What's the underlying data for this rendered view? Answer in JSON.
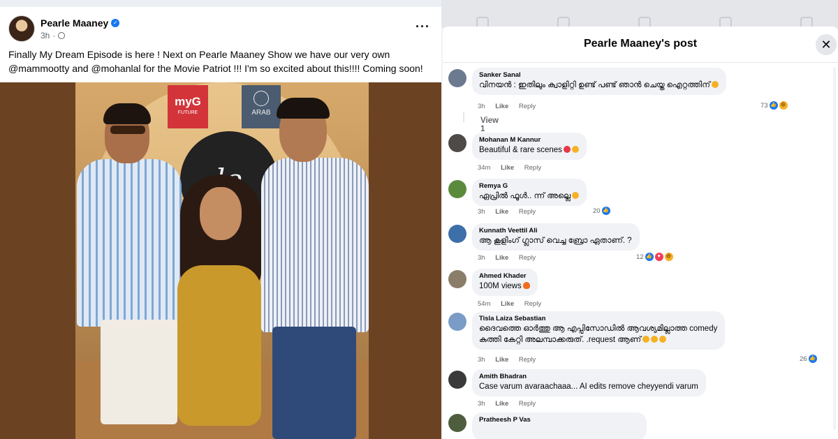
{
  "post": {
    "author": "Pearle Maaney",
    "time": "3h",
    "text": "Finally My Dream Episode is here ! Next on Pearle Maaney Show we have our very own @mammootty and @mohanlal for the Movie Patriot !!! I'm so excited about this!!!! Coming soon!",
    "photo": {
      "logo_myg": "myG",
      "logo_myg_sub": "FUTURE",
      "logo_arab": "ARAB",
      "ring_text": "le"
    }
  },
  "dialog": {
    "title": "Pearle Maaney's post",
    "close_icon": "close-icon"
  },
  "comments": [
    {
      "name": "Sanker Sanal",
      "text": "വിനയൻ : ഇതിലും ക്വാളിറ്റി ഉണ്ട് പണ്ട് ഞാൻ ചെയ്ത ഐറ്റത്തിന്",
      "time": "3h",
      "like": "Like",
      "reply": "Reply",
      "reactions": "73",
      "view_replies": "View 1 reply",
      "avatar_color": "#6b7a8f"
    },
    {
      "name": "Mohanan M Kannur",
      "text": "Beautiful & rare scenes",
      "time": "34m",
      "like": "Like",
      "reply": "Reply",
      "avatar_color": "#4e4a48"
    },
    {
      "name": "Remya G",
      "text": "ഏപ്രിൽ ഫൂൾ.. ന്ന് അല്ലെ",
      "time": "3h",
      "like": "Like",
      "reply": "Reply",
      "reactions": "20",
      "avatar_color": "#5b8a3c"
    },
    {
      "name": "Kunnath Veettil Ali",
      "text": "ആ കൂളിംഗ് ഗ്ലാസ്‌ വെച്ച ബ്രോ ഏതാണ്. ?",
      "time": "3h",
      "like": "Like",
      "reply": "Reply",
      "reactions": "12",
      "avatar_color": "#3d6fa8"
    },
    {
      "name": "Ahmed Khader",
      "text": "100M views",
      "time": "54m",
      "like": "Like",
      "reply": "Reply",
      "avatar_color": "#8a7d6a"
    },
    {
      "name": "Tisla Laiza Sebastian",
      "text_line1": "ദൈവത്തെ ഓർത്തു ആ എപ്പിസോഡിൽ ആവശ്യമില്ലാത്ത comedy",
      "text_line2": "കുത്തി കേറ്റി അലമ്പാക്കരുത്. .request ആണ്",
      "time": "3h",
      "like": "Like",
      "reply": "Reply",
      "reactions": "26",
      "avatar_color": "#7a9cc6"
    },
    {
      "name": "Amith Bhadran",
      "text": "Case varum avaraachaaa... AI edits remove cheyyendi varum",
      "time": "3h",
      "like": "Like",
      "reply": "Reply",
      "avatar_color": "#3a3a3a"
    },
    {
      "name": "Pratheesh P Vas",
      "text": "",
      "avatar_color": "#4d5d3e"
    }
  ]
}
